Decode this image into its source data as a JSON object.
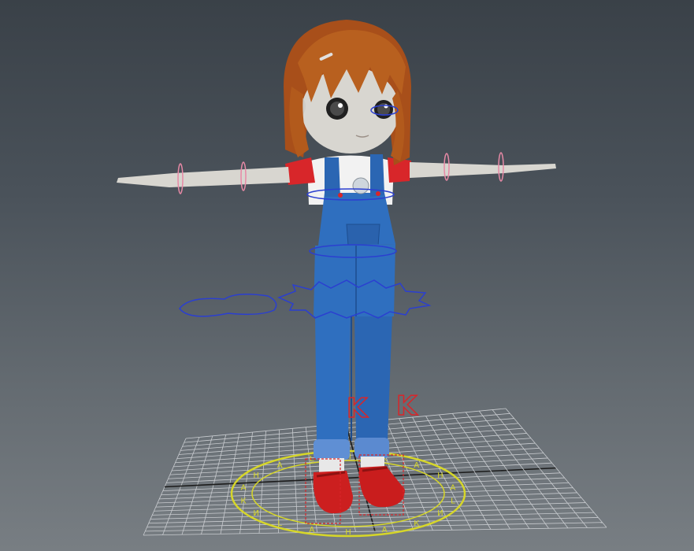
{
  "viewport": {
    "background_top": "#3a4148",
    "background_bottom": "#787e83"
  },
  "character": {
    "hair_color": "#b0561e",
    "skin_color": "#d8d6d0",
    "shirt_color": "#f2f2f2",
    "sleeve_color": "#d8262a",
    "overalls_color": "#2f6fbf",
    "shoes_color": "#cc1f1f"
  },
  "rig": {
    "fk_control_color": "#e889a6",
    "body_control_color": "#2b3fd0",
    "ik_handle_color": "#d8262a",
    "ik_labels": [
      "K",
      "K"
    ],
    "root_control_color": "#d6d629",
    "root_ring_text": "ИКАНАL ИКАНАL ИКАНАL"
  },
  "ground_grid": {
    "line_color": "#c9ccd0",
    "axis_color": "#1c1c1c"
  }
}
